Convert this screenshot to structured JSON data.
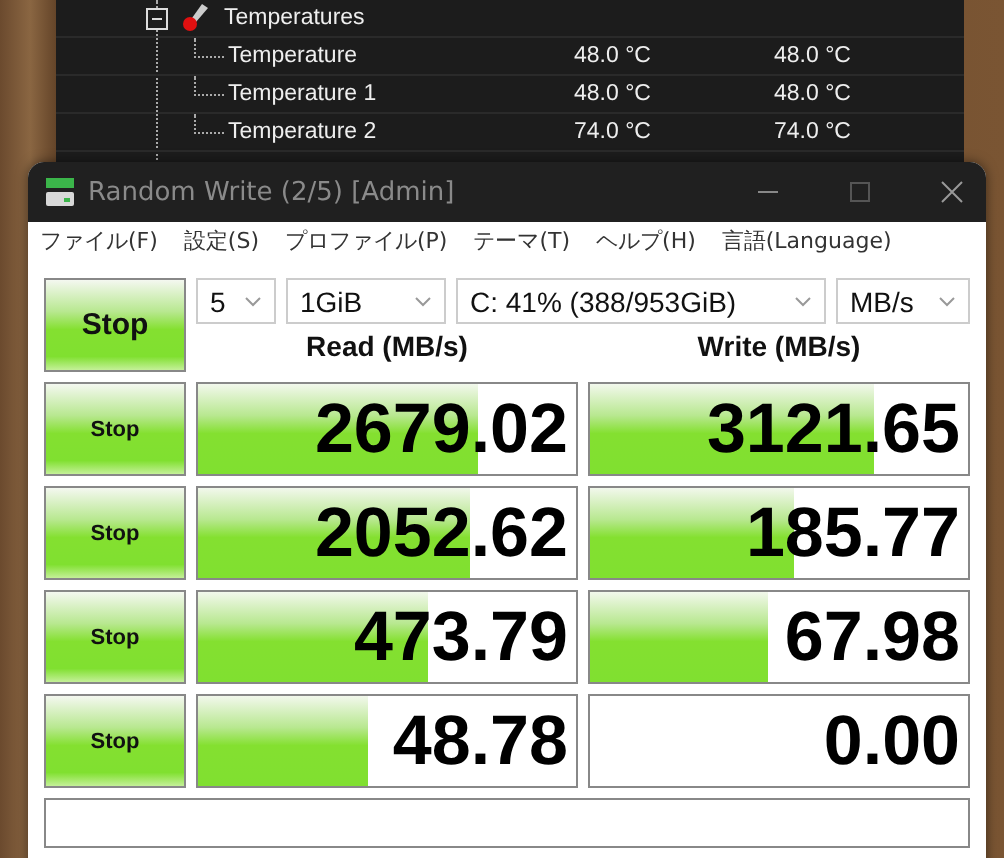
{
  "background_window": {
    "tree": [
      {
        "label": "Temperatures",
        "expanded": true,
        "children": [
          {
            "label": "Temperature",
            "value": "48.0 °C",
            "max": "48.0 °C"
          },
          {
            "label": "Temperature 1",
            "value": "48.0 °C",
            "max": "48.0 °C"
          },
          {
            "label": "Temperature 2",
            "value": "74.0 °C",
            "max": "74.0 °C"
          }
        ]
      }
    ]
  },
  "window": {
    "title": "Random Write (2/5) [Admin]"
  },
  "menu": [
    "ファイル(F)",
    "設定(S)",
    "プロファイル(P)",
    "テーマ(T)",
    "ヘルプ(H)",
    "言語(Language)"
  ],
  "controls": {
    "main_button": "Stop",
    "count": "5",
    "size": "1GiB",
    "drive": "C: 41% (388/953GiB)",
    "unit": "MB/s"
  },
  "headers": {
    "read": "Read (MB/s)",
    "write": "Write (MB/s)"
  },
  "rows": [
    {
      "button": "Stop",
      "read": {
        "value": "2679.02",
        "level": 0.74
      },
      "write": {
        "value": "3121.65",
        "level": 0.75
      }
    },
    {
      "button": "Stop",
      "read": {
        "value": "2052.62",
        "level": 0.72
      },
      "write": {
        "value": "185.77",
        "level": 0.54
      }
    },
    {
      "button": "Stop",
      "read": {
        "value": "473.79",
        "level": 0.61
      },
      "write": {
        "value": "67.98",
        "level": 0.47
      }
    },
    {
      "button": "Stop",
      "read": {
        "value": "48.78",
        "level": 0.45
      },
      "write": {
        "value": "0.00"
      }
    }
  ]
}
